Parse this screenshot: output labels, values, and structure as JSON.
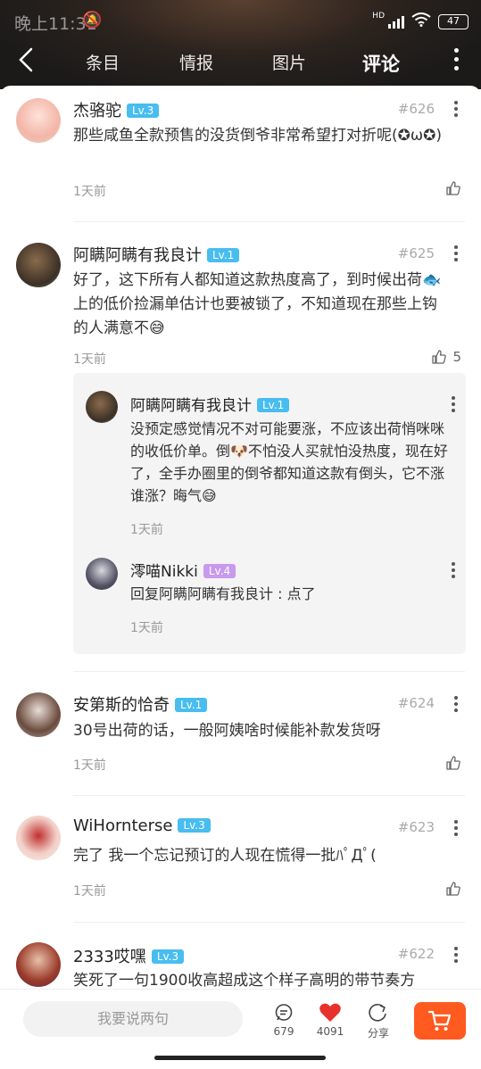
{
  "status": {
    "time": "晚上11:31",
    "hd": "HD",
    "battery": "47"
  },
  "nav": {
    "tabs": [
      "条目",
      "情报",
      "图片",
      "评论"
    ],
    "active": "评论"
  },
  "comments": [
    {
      "user": "杰骆驼",
      "level": "Lv.3",
      "floor": "#626",
      "text": "那些咸鱼全款预售的没货倒爷非常希望打对折呢(✪ω✪)",
      "time": "1天前",
      "likes": ""
    },
    {
      "user": "阿瞒阿瞒有我良计",
      "level": "Lv.1",
      "floor": "#625",
      "text": "好了，这下所有人都知道这款热度高了，到时候出荷🐟上的低价捡漏单估计也要被锁了，不知道现在那些上钩的人满意不😅",
      "time": "1天前",
      "likes": "5"
    },
    {
      "user": "安第斯的恰奇",
      "level": "Lv.1",
      "floor": "#624",
      "text": "30号出荷的话，一般阿姨啥时候能补款发货呀",
      "time": "1天前",
      "likes": ""
    },
    {
      "user": "WiHornterse",
      "level": "Lv.3",
      "floor": "#623",
      "text": "完了 我一个忘记预订的人现在慌得一批ﾊﾟДﾟ(",
      "time": "1天前",
      "likes": ""
    },
    {
      "user": "2333哎嘿",
      "level": "Lv.3",
      "floor": "#622",
      "text": "笑死了一句1900收高超成这个样子高明的带节奏方",
      "time": "",
      "likes": ""
    }
  ],
  "replies": [
    {
      "user": "阿瞒阿瞒有我良计",
      "level": "Lv.1",
      "text": "没预定感觉情况不对可能要涨，不应该出荷悄咪咪的收低价单。倒🐶不怕没人买就怕没热度，现在好了，全手办圈里的倒爷都知道这款有倒头，它不涨谁涨？晦气😅",
      "time": "1天前"
    },
    {
      "user": "澪喵Nikki",
      "level": "Lv.4",
      "text": "回复阿瞒阿瞒有我良计 : 点了",
      "time": "1天前"
    }
  ],
  "bottom": {
    "placeholder": "我要说两句",
    "comments": "679",
    "likes": "4091",
    "share": "分享"
  },
  "colors": {
    "accent": "#ff5a1f",
    "level_blue": "#48bdf0",
    "level_purple": "#c79aee",
    "like_red": "#e8312c"
  }
}
